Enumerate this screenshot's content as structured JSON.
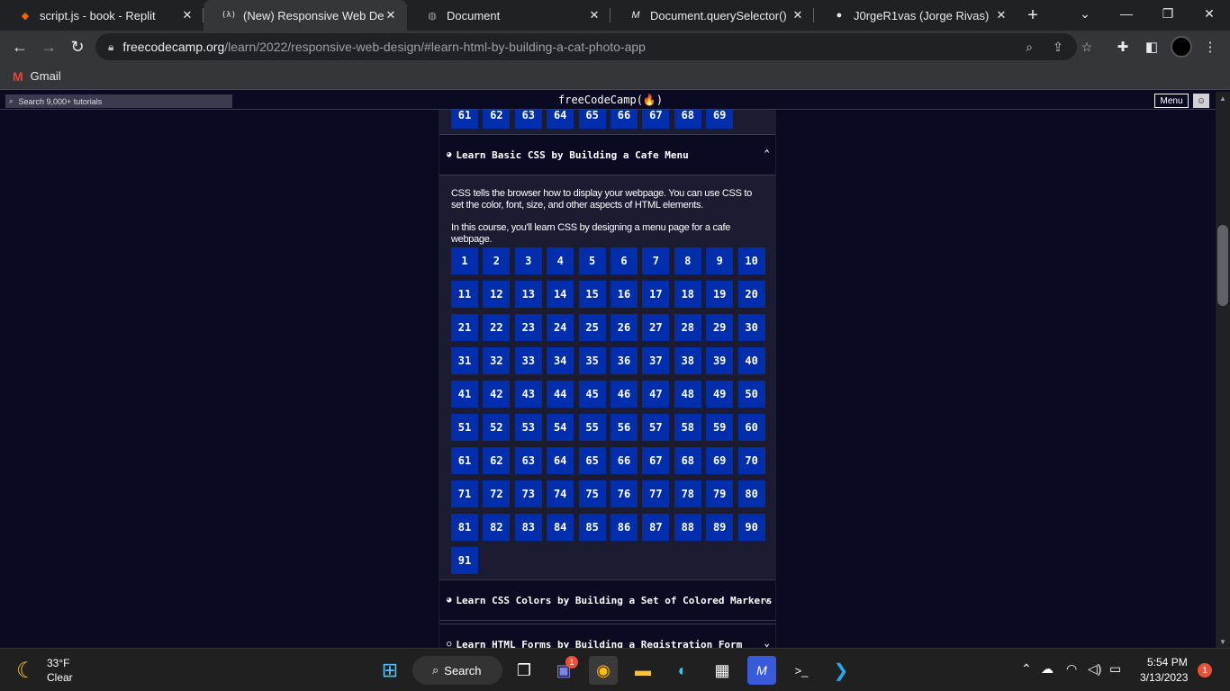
{
  "browser": {
    "tabs": [
      {
        "title": "script.js - book - Replit",
        "icon": "replit-icon"
      },
      {
        "title": "(New) Responsive Web Desig",
        "icon": "freecodecamp-icon"
      },
      {
        "title": "Document",
        "icon": "globe-icon"
      },
      {
        "title": "Document.querySelector() - W",
        "icon": "mdn-icon"
      },
      {
        "title": "J0rgeR1vas (Jorge Rivas)",
        "icon": "github-icon"
      }
    ],
    "url_host": "freecodecamp.org",
    "url_path": "/learn/2022/responsive-web-design/#learn-html-by-building-a-cat-photo-app",
    "bookmark_gmail": "Gmail"
  },
  "fcc": {
    "search_placeholder": "Search 9,000+ tutorials",
    "logo": "freeCodeCamp(🔥)",
    "menu_label": "Menu"
  },
  "prev_block_steps": [
    "61",
    "62",
    "63",
    "64",
    "65",
    "66",
    "67",
    "68",
    "69"
  ],
  "cafe_block": {
    "title": "Learn Basic CSS by Building a Cafe Menu",
    "description_1": "CSS tells the browser how to display your webpage. You can use CSS to set the color, font, size, and other aspects of HTML elements.",
    "description_2": "In this course, you'll learn CSS by designing a menu page for a cafe webpage.",
    "steps": [
      "1",
      "2",
      "3",
      "4",
      "5",
      "6",
      "7",
      "8",
      "9",
      "10",
      "11",
      "12",
      "13",
      "14",
      "15",
      "16",
      "17",
      "18",
      "19",
      "20",
      "21",
      "22",
      "23",
      "24",
      "25",
      "26",
      "27",
      "28",
      "29",
      "30",
      "31",
      "32",
      "33",
      "34",
      "35",
      "36",
      "37",
      "38",
      "39",
      "40",
      "41",
      "42",
      "43",
      "44",
      "45",
      "46",
      "47",
      "48",
      "49",
      "50",
      "51",
      "52",
      "53",
      "54",
      "55",
      "56",
      "57",
      "58",
      "59",
      "60",
      "61",
      "62",
      "63",
      "64",
      "65",
      "66",
      "67",
      "68",
      "69",
      "70",
      "71",
      "72",
      "73",
      "74",
      "75",
      "76",
      "77",
      "78",
      "79",
      "80",
      "81",
      "82",
      "83",
      "84",
      "85",
      "86",
      "87",
      "88",
      "89",
      "90",
      "91"
    ]
  },
  "next_blocks": [
    {
      "title": "Learn CSS Colors by Building a Set of Colored Markers",
      "status": "in-progress"
    },
    {
      "title": "Learn HTML Forms by Building a Registration Form",
      "status": "not-started"
    }
  ],
  "taskbar": {
    "temp": "33°F",
    "condition": "Clear",
    "search_label": "Search",
    "time": "5:54 PM",
    "date": "3/13/2023",
    "notification_count": "1",
    "chat_badge": "1"
  }
}
